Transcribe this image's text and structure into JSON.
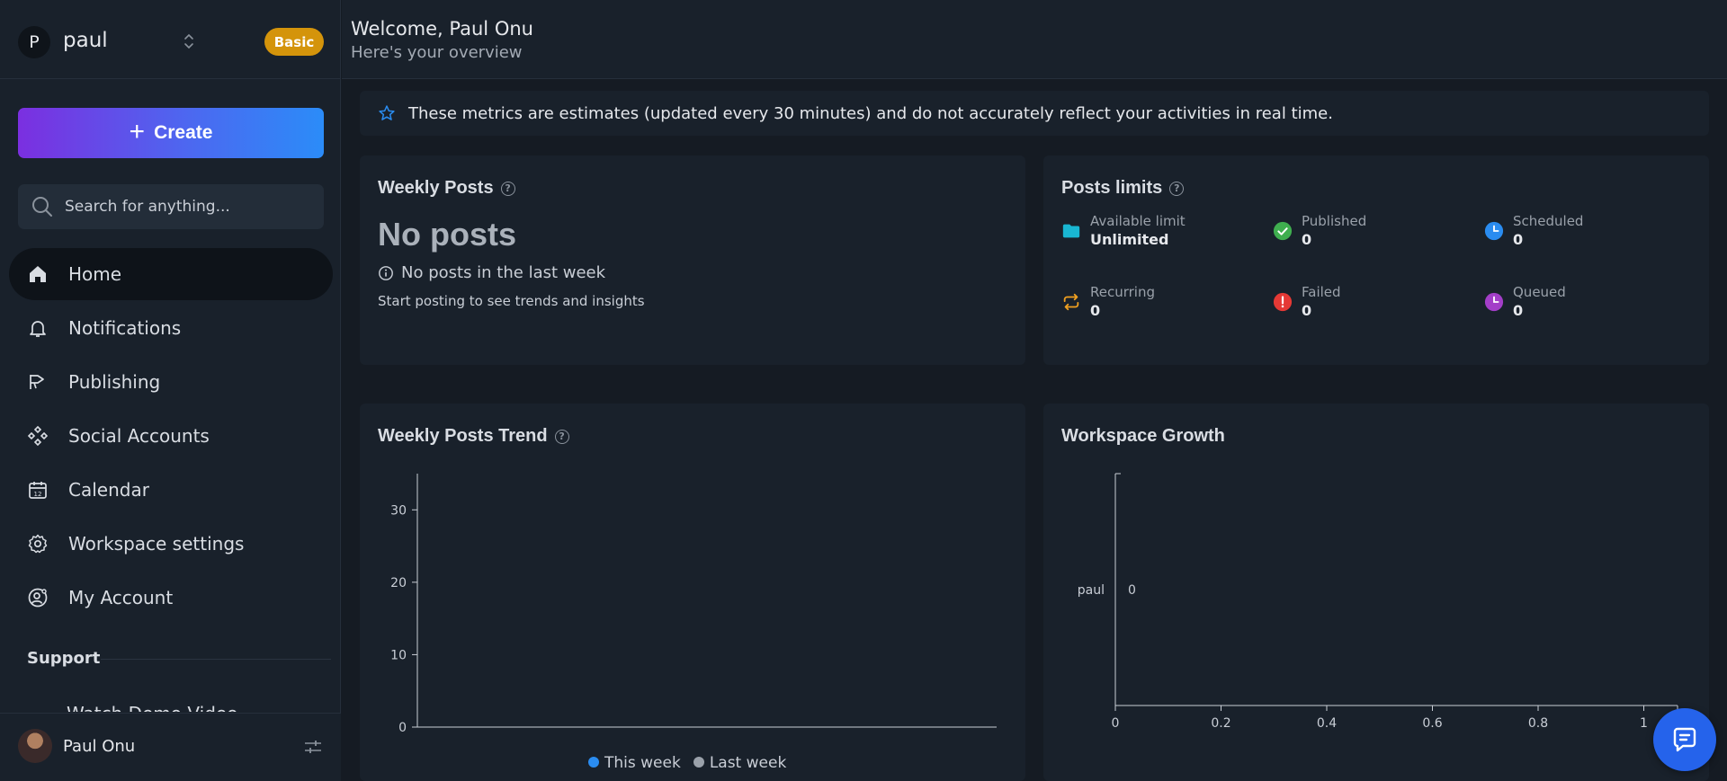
{
  "workspace": {
    "initial": "P",
    "name": "paul",
    "plan": "Basic"
  },
  "sidebar": {
    "create_label": "Create",
    "search_placeholder": "Search for anything...",
    "items": [
      {
        "label": "Home",
        "icon": "home-icon",
        "active": true
      },
      {
        "label": "Notifications",
        "icon": "bell-icon"
      },
      {
        "label": "Publishing",
        "icon": "megaphone-icon"
      },
      {
        "label": "Social Accounts",
        "icon": "grid-diamond-icon"
      },
      {
        "label": "Calendar",
        "icon": "calendar-icon"
      },
      {
        "label": "Workspace settings",
        "icon": "gear-icon"
      },
      {
        "label": "My Account",
        "icon": "user-gear-icon"
      }
    ],
    "support_heading": "Support",
    "support_link": "Watch Demo Video"
  },
  "user": {
    "name": "Paul Onu"
  },
  "header": {
    "welcome": "Welcome, Paul Onu",
    "subtitle": "Here's your overview"
  },
  "notice": "These metrics are estimates (updated every 30 minutes) and do not accurately reflect your activities in real time.",
  "weekly_posts": {
    "title": "Weekly Posts",
    "headline": "No posts",
    "subline": "No posts in the last week",
    "hint": "Start posting to see trends and insights"
  },
  "posts_limits": {
    "title": "Posts limits",
    "stats": [
      {
        "label": "Available limit",
        "value": "Unlimited",
        "icon": "folder-icon",
        "color": "#19b6d2"
      },
      {
        "label": "Published",
        "value": "0",
        "icon": "check-circle-icon",
        "color": "#3fae4f"
      },
      {
        "label": "Scheduled",
        "value": "0",
        "icon": "clock-icon",
        "color": "#2a8cf0"
      },
      {
        "label": "Recurring",
        "value": "0",
        "icon": "repeat-icon",
        "color": "#f0a020"
      },
      {
        "label": "Failed",
        "value": "0",
        "icon": "alert-circle-icon",
        "color": "#e53935"
      },
      {
        "label": "Queued",
        "value": "0",
        "icon": "clock-purple-icon",
        "color": "#a33ec8"
      }
    ]
  },
  "trend": {
    "title": "Weekly Posts Trend",
    "legend": [
      {
        "name": "This week",
        "color": "#2a8cf0"
      },
      {
        "name": "Last week",
        "color": "#9aa1aa"
      }
    ]
  },
  "growth": {
    "title": "Workspace Growth"
  },
  "chart_data": [
    {
      "type": "line",
      "title": "Weekly Posts Trend",
      "xlabel": "",
      "ylabel": "",
      "ylim": [
        0,
        35
      ],
      "yticks": [
        0,
        10,
        20,
        30
      ],
      "series": [
        {
          "name": "This week",
          "values": []
        },
        {
          "name": "Last week",
          "values": []
        }
      ],
      "legend": "bottom"
    },
    {
      "type": "bar",
      "title": "Workspace Growth",
      "orientation": "horizontal",
      "categories": [
        "paul"
      ],
      "values": [
        0
      ],
      "xlim": [
        0,
        1.2
      ],
      "xticks": [
        0,
        0.2,
        0.4,
        0.6,
        0.8,
        1
      ],
      "data_labels": [
        "0"
      ]
    }
  ]
}
